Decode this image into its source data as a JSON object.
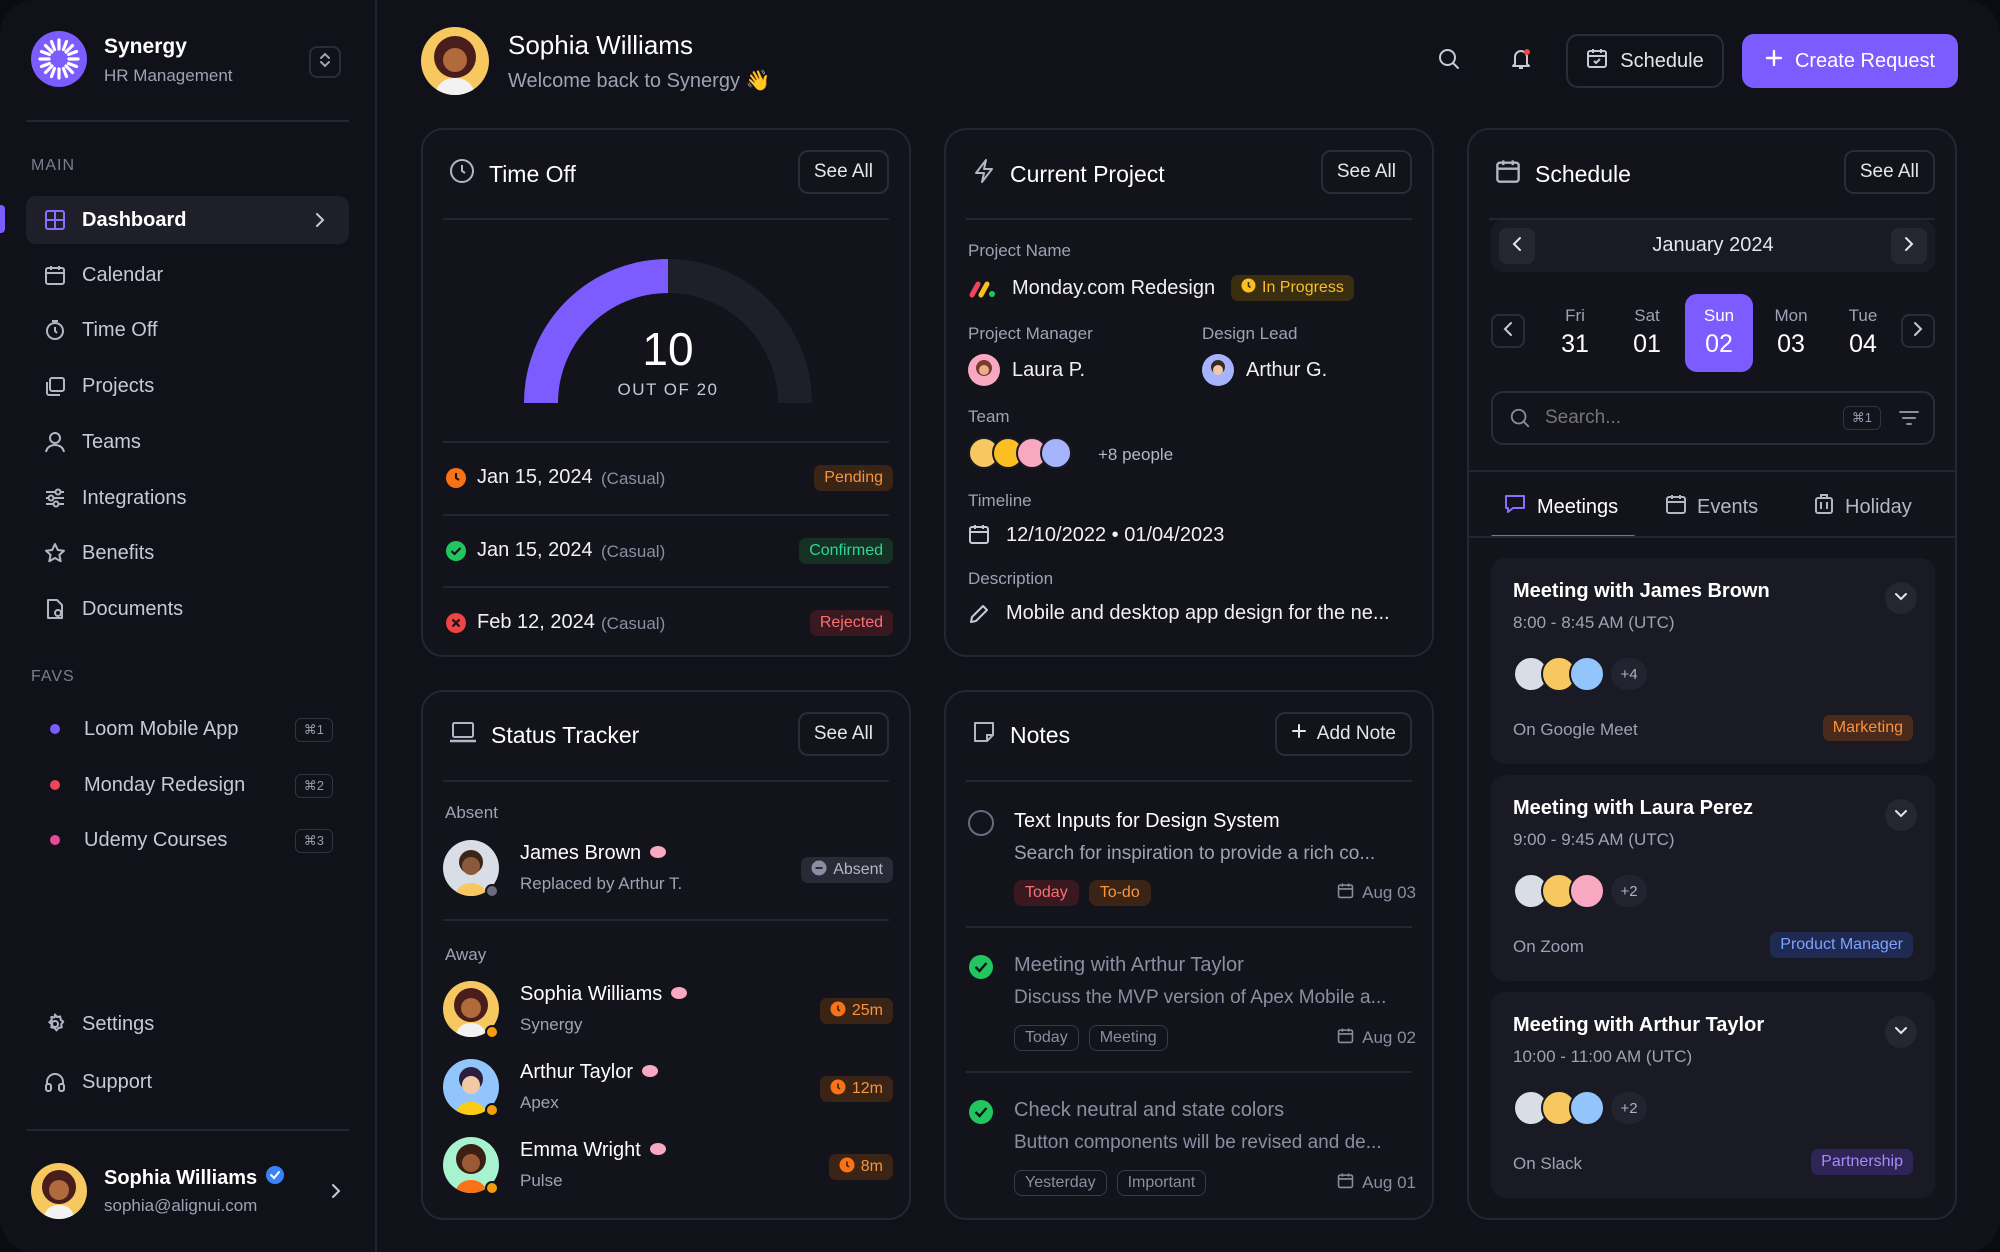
{
  "brand": {
    "name": "Synergy",
    "subtitle": "HR Management"
  },
  "sidebar": {
    "main_label": "MAIN",
    "items": [
      {
        "label": "Dashboard",
        "icon": "grid-icon",
        "active": true
      },
      {
        "label": "Calendar",
        "icon": "calendar-icon"
      },
      {
        "label": "Time Off",
        "icon": "timer-icon"
      },
      {
        "label": "Projects",
        "icon": "folders-icon"
      },
      {
        "label": "Teams",
        "icon": "user-icon"
      },
      {
        "label": "Integrations",
        "icon": "sliders-icon"
      },
      {
        "label": "Benefits",
        "icon": "star-icon"
      },
      {
        "label": "Documents",
        "icon": "document-icon"
      }
    ],
    "favs_label": "FAVS",
    "favs": [
      {
        "label": "Loom Mobile App",
        "shortcut": "⌘1",
        "color": "#7c5cff"
      },
      {
        "label": "Monday Redesign",
        "shortcut": "⌘2",
        "color": "#f0445a"
      },
      {
        "label": "Udemy Courses",
        "shortcut": "⌘3",
        "color": "#ec4899"
      }
    ],
    "settings": "Settings",
    "support": "Support",
    "user": {
      "name": "Sophia Williams",
      "email": "sophia@alignui.com"
    }
  },
  "header": {
    "name": "Sophia Williams",
    "welcome": "Welcome back to Synergy 👋",
    "schedule_btn": "Schedule",
    "create_btn": "Create Request"
  },
  "time_off": {
    "title": "Time Off",
    "see_all": "See All",
    "value": 10,
    "total": 20,
    "value_label": "10",
    "out_of": "OUT OF 20",
    "entries": [
      {
        "date": "Jan 15, 2024",
        "type": "(Casual)",
        "status": "Pending",
        "color": "#f97316"
      },
      {
        "date": "Jan 15, 2024",
        "type": "(Casual)",
        "status": "Confirmed",
        "color": "#22c55e"
      },
      {
        "date": "Feb 12, 2024",
        "type": "(Casual)",
        "status": "Rejected",
        "color": "#ef4444"
      }
    ]
  },
  "project": {
    "title": "Current Project",
    "see_all": "See All",
    "name_label": "Project Name",
    "name": "Monday.com Redesign",
    "status": "In Progress",
    "manager_label": "Project Manager",
    "manager": "Laura P.",
    "lead_label": "Design Lead",
    "lead": "Arthur G.",
    "team_label": "Team",
    "team_more": "+8 people",
    "timeline_label": "Timeline",
    "timeline": "12/10/2022 • 01/04/2023",
    "description_label": "Description",
    "description": "Mobile and desktop app design for the ne..."
  },
  "status_tracker": {
    "title": "Status Tracker",
    "see_all": "See All",
    "absent_label": "Absent",
    "absent": {
      "name": "James Brown",
      "sub": "Replaced by Arthur T.",
      "badge": "Absent"
    },
    "away_label": "Away",
    "away": [
      {
        "name": "Sophia Williams",
        "sub": "Synergy",
        "time": "25m"
      },
      {
        "name": "Arthur Taylor",
        "sub": "Apex",
        "time": "12m"
      },
      {
        "name": "Emma Wright",
        "sub": "Pulse",
        "time": "8m"
      }
    ]
  },
  "notes": {
    "title": "Notes",
    "add": "Add Note",
    "items": [
      {
        "title": "Text Inputs for Design System",
        "body": "Search for inspiration to provide a rich co...",
        "tags": [
          "Today",
          "To-do"
        ],
        "date": "Aug 03",
        "done": false
      },
      {
        "title": "Meeting with Arthur Taylor",
        "body": "Discuss the MVP version of Apex Mobile a...",
        "tags": [
          "Today",
          "Meeting"
        ],
        "date": "Aug 02",
        "done": true
      },
      {
        "title": "Check neutral and state colors",
        "body": "Button components will be revised and de...",
        "tags": [
          "Yesterday",
          "Important"
        ],
        "date": "Aug 01",
        "done": true
      }
    ]
  },
  "schedule": {
    "title": "Schedule",
    "see_all": "See All",
    "month": "January 2024",
    "days": [
      {
        "name": "Fri",
        "num": "31"
      },
      {
        "name": "Sat",
        "num": "01"
      },
      {
        "name": "Sun",
        "num": "02",
        "selected": true
      },
      {
        "name": "Mon",
        "num": "03"
      },
      {
        "name": "Tue",
        "num": "04"
      }
    ],
    "search_placeholder": "Search...",
    "search_shortcut": "⌘1",
    "tabs": [
      "Meetings",
      "Events",
      "Holiday"
    ],
    "meetings": [
      {
        "title": "Meeting with James Brown",
        "time": "8:00 - 8:45 AM (UTC)",
        "more": "+4",
        "where": "On Google Meet",
        "tag": "Marketing",
        "tag_bg": "#4a2a1a",
        "tag_fg": "#fb923c"
      },
      {
        "title": "Meeting with Laura Perez",
        "time": "9:00 - 9:45 AM (UTC)",
        "more": "+2",
        "where": "On Zoom",
        "tag": "Product Manager",
        "tag_bg": "#1e2a52",
        "tag_fg": "#7ea2ff"
      },
      {
        "title": "Meeting with Arthur Taylor",
        "time": "10:00 - 11:00 AM (UTC)",
        "more": "+2",
        "where": "On Slack",
        "tag": "Partnership",
        "tag_bg": "#2f2456",
        "tag_fg": "#a78bfa"
      }
    ]
  }
}
